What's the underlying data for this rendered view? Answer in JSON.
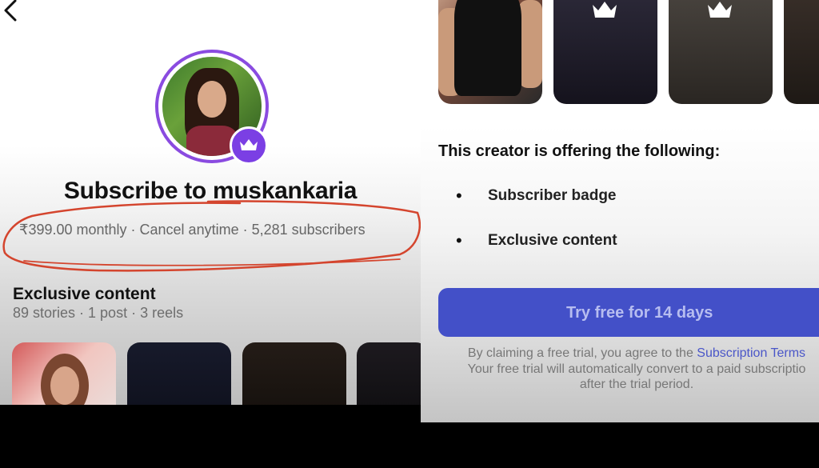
{
  "profile": {
    "title": "Subscribe to muskankaria",
    "meta": "₹399.00 monthly · Cancel anytime · 5,281 subscribers"
  },
  "exclusive": {
    "title": "Exclusive content",
    "counts": "89 stories · 1 post · 3 reels"
  },
  "offer": {
    "title": "This creator is offering the following:",
    "items": [
      "Subscriber badge",
      "Exclusive content"
    ],
    "bullet": "•"
  },
  "trial": {
    "button_label": "Try free for 14 days",
    "legal_line1_prefix": "By claiming a free trial, you agree to the ",
    "legal_link": "Subscription Terms",
    "legal_line2": "Your free trial will automatically convert to a paid subscriptio",
    "legal_line3": "after the trial period."
  },
  "icons": {
    "back": "chevron-left-icon",
    "crown": "crown-icon"
  },
  "colors": {
    "accent_purple": "#7b3fe4",
    "button_blue": "#4350c8",
    "annotation_red": "#d4452e"
  }
}
